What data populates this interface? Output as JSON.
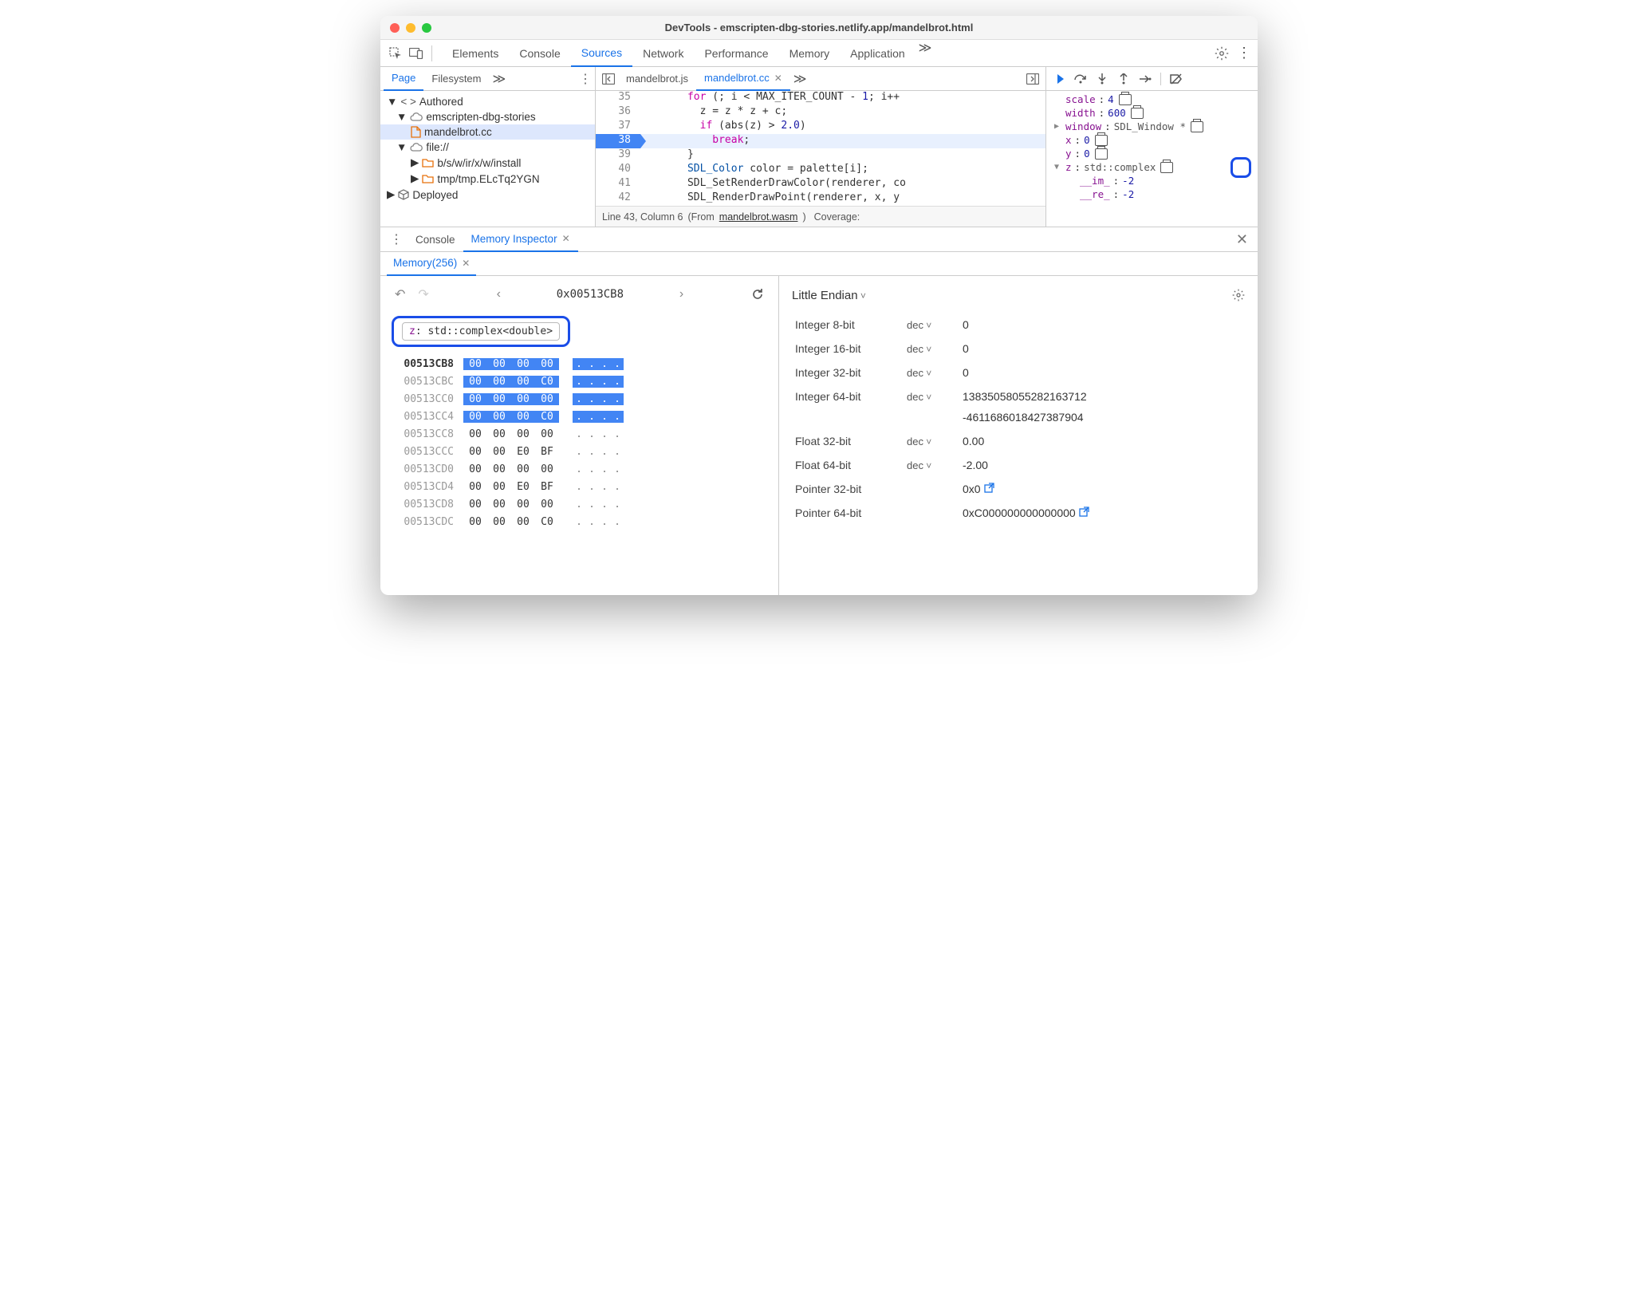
{
  "window": {
    "title": "DevTools - emscripten-dbg-stories.netlify.app/mandelbrot.html"
  },
  "mainTabs": {
    "items": [
      "Elements",
      "Console",
      "Sources",
      "Network",
      "Performance",
      "Memory",
      "Application"
    ],
    "active": "Sources"
  },
  "leftPanel": {
    "tabs": {
      "items": [
        "Page",
        "Filesystem"
      ],
      "active": "Page"
    },
    "tree": {
      "authored": "Authored",
      "origin": "emscripten-dbg-stories",
      "file": "mandelbrot.cc",
      "file_root": "file://",
      "folder1": "b/s/w/ir/x/w/install",
      "folder2": "tmp/tmp.ELcTq2YGN",
      "deployed": "Deployed"
    }
  },
  "fileTabs": {
    "items": [
      {
        "name": "mandelbrot.js",
        "active": false
      },
      {
        "name": "mandelbrot.cc",
        "active": true
      }
    ]
  },
  "code": {
    "lines": [
      {
        "n": 35,
        "text": "      for (; i < MAX_ITER_COUNT - 1; i++"
      },
      {
        "n": 36,
        "text": "        z = z * z + c;"
      },
      {
        "n": 37,
        "text": "        if (abs(z) > 2.0)"
      },
      {
        "n": 38,
        "text": "          break;"
      },
      {
        "n": 39,
        "text": "      }"
      },
      {
        "n": 40,
        "text": "      SDL_Color color = palette[i];"
      },
      {
        "n": 41,
        "text": "      SDL_SetRenderDrawColor(renderer, co"
      },
      {
        "n": 42,
        "text": "      SDL_RenderDrawPoint(renderer, x, y"
      }
    ],
    "currentLine": 38,
    "status": {
      "pos": "Line 43, Column 6",
      "from": "(From ",
      "link": "mandelbrot.wasm",
      "suffix": ")",
      "cov": "Coverage:"
    }
  },
  "scope": {
    "rows": [
      {
        "name": "scale",
        "val": "4",
        "type": "",
        "icon": true,
        "indent": 0,
        "arrow": ""
      },
      {
        "name": "width",
        "val": "600",
        "type": "",
        "icon": true,
        "indent": 0,
        "arrow": ""
      },
      {
        "name": "window",
        "val": "",
        "type": "SDL_Window *",
        "icon": true,
        "indent": 0,
        "arrow": "▶"
      },
      {
        "name": "x",
        "val": "0",
        "type": "",
        "icon": true,
        "indent": 0,
        "arrow": ""
      },
      {
        "name": "y",
        "val": "0",
        "type": "",
        "icon": true,
        "indent": 0,
        "arrow": ""
      },
      {
        "name": "z",
        "val": "",
        "type": "std::complex<double>",
        "icon": true,
        "indent": 0,
        "arrow": "▼",
        "highlight": true
      },
      {
        "name": "__im_",
        "val": "-2",
        "type": "",
        "icon": false,
        "indent": 1,
        "arrow": ""
      },
      {
        "name": "__re_",
        "val": "-2",
        "type": "",
        "icon": false,
        "indent": 1,
        "arrow": ""
      }
    ]
  },
  "drawer": {
    "tabs": [
      {
        "name": "Console",
        "active": false
      },
      {
        "name": "Memory Inspector",
        "active": true
      }
    ],
    "subtab": "Memory(256)"
  },
  "memory": {
    "address": "0x00513CB8",
    "chip": {
      "name": "z",
      "type": "std::complex<double>"
    },
    "rows": [
      {
        "addr": "00513CB8",
        "bytes": [
          "00",
          "00",
          "00",
          "00"
        ],
        "hl": true,
        "bold": true
      },
      {
        "addr": "00513CBC",
        "bytes": [
          "00",
          "00",
          "00",
          "C0"
        ],
        "hl": true
      },
      {
        "addr": "00513CC0",
        "bytes": [
          "00",
          "00",
          "00",
          "00"
        ],
        "hl": true
      },
      {
        "addr": "00513CC4",
        "bytes": [
          "00",
          "00",
          "00",
          "C0"
        ],
        "hl": true
      },
      {
        "addr": "00513CC8",
        "bytes": [
          "00",
          "00",
          "00",
          "00"
        ],
        "hl": false
      },
      {
        "addr": "00513CCC",
        "bytes": [
          "00",
          "00",
          "E0",
          "BF"
        ],
        "hl": false
      },
      {
        "addr": "00513CD0",
        "bytes": [
          "00",
          "00",
          "00",
          "00"
        ],
        "hl": false
      },
      {
        "addr": "00513CD4",
        "bytes": [
          "00",
          "00",
          "E0",
          "BF"
        ],
        "hl": false
      },
      {
        "addr": "00513CD8",
        "bytes": [
          "00",
          "00",
          "00",
          "00"
        ],
        "hl": false
      },
      {
        "addr": "00513CDC",
        "bytes": [
          "00",
          "00",
          "00",
          "C0"
        ],
        "hl": false
      }
    ]
  },
  "interpret": {
    "endian": "Little Endian",
    "rows": [
      {
        "type": "Integer 8-bit",
        "fmt": "dec",
        "val": "0"
      },
      {
        "type": "Integer 16-bit",
        "fmt": "dec",
        "val": "0"
      },
      {
        "type": "Integer 32-bit",
        "fmt": "dec",
        "val": "0"
      },
      {
        "type": "Integer 64-bit",
        "fmt": "dec",
        "val": "13835058055282163712",
        "val2": "-4611686018427387904"
      },
      {
        "type": "Float 32-bit",
        "fmt": "dec",
        "val": "0.00"
      },
      {
        "type": "Float 64-bit",
        "fmt": "dec",
        "val": "-2.00"
      },
      {
        "type": "Pointer 32-bit",
        "fmt": "",
        "val": "0x0",
        "link": true
      },
      {
        "type": "Pointer 64-bit",
        "fmt": "",
        "val": "0xC000000000000000",
        "link": true
      }
    ]
  }
}
